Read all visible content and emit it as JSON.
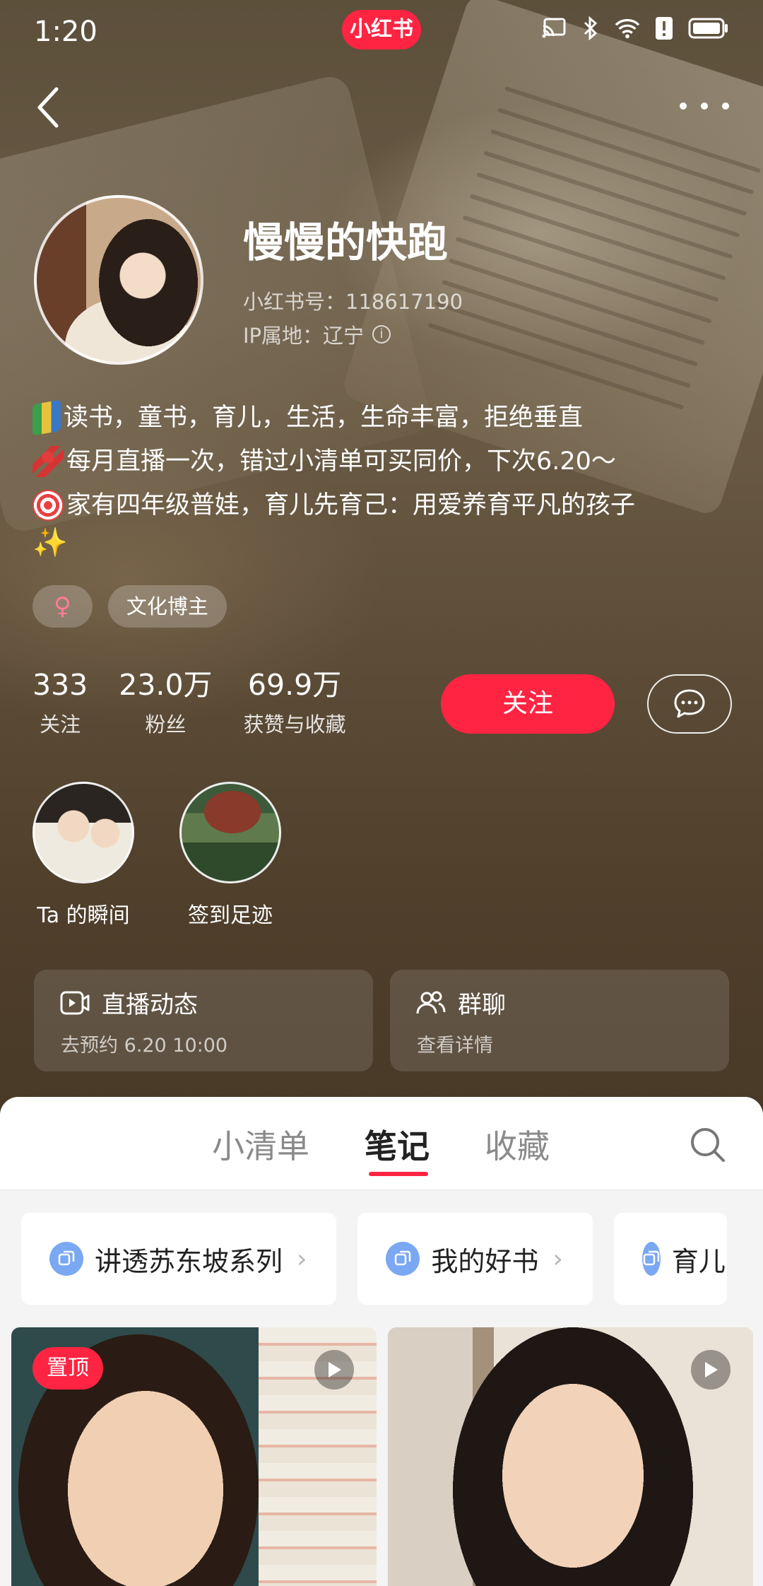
{
  "status": {
    "time": "1:20",
    "app_logo": "小红书",
    "icons": [
      "cast-icon",
      "bluetooth-icon",
      "wifi-icon",
      "alert-icon",
      "battery-icon"
    ]
  },
  "profile": {
    "name": "慢慢的快跑",
    "id_text": "小红书号：118617190",
    "ip_text": "IP属地：辽宁",
    "bio": [
      {
        "emoji": "books-emoji",
        "text": "读书，童书，育儿，生活，生命丰富，拒绝垂直"
      },
      {
        "emoji": "ribbon-emoji",
        "text": " 每月直播一次，错过小清单可买同价，下次6.20～"
      },
      {
        "emoji": "target-emoji",
        "text": "家有四年级普娃，育儿先育己：用爱养育平凡的孩子"
      },
      {
        "emoji": "sparkles-emoji",
        "text": "✨"
      }
    ],
    "tags": {
      "gender": "♀",
      "category": "文化博主"
    }
  },
  "stats": [
    {
      "value": "333",
      "label": "关注"
    },
    {
      "value": "23.0万",
      "label": "粉丝"
    },
    {
      "value": "69.9万",
      "label": "获赞与收藏"
    }
  ],
  "actions": {
    "follow": "关注"
  },
  "moments": [
    {
      "label": "Ta 的瞬间"
    },
    {
      "label": "签到足迹"
    }
  ],
  "cards": {
    "live": {
      "title": "直播动态",
      "sub": "去预约 6.20 10:00"
    },
    "group": {
      "title": "群聊",
      "sub": "查看详情"
    }
  },
  "tabs": [
    "小清单",
    "笔记",
    "收藏"
  ],
  "active_tab": "笔记",
  "collections": [
    "讲透苏东坡系列",
    "我的好书",
    "育儿&"
  ],
  "notes": [
    {
      "badge": "置顶"
    }
  ],
  "colors": {
    "accent": "#ff2442",
    "collection_icon": "#7aa8f2"
  }
}
